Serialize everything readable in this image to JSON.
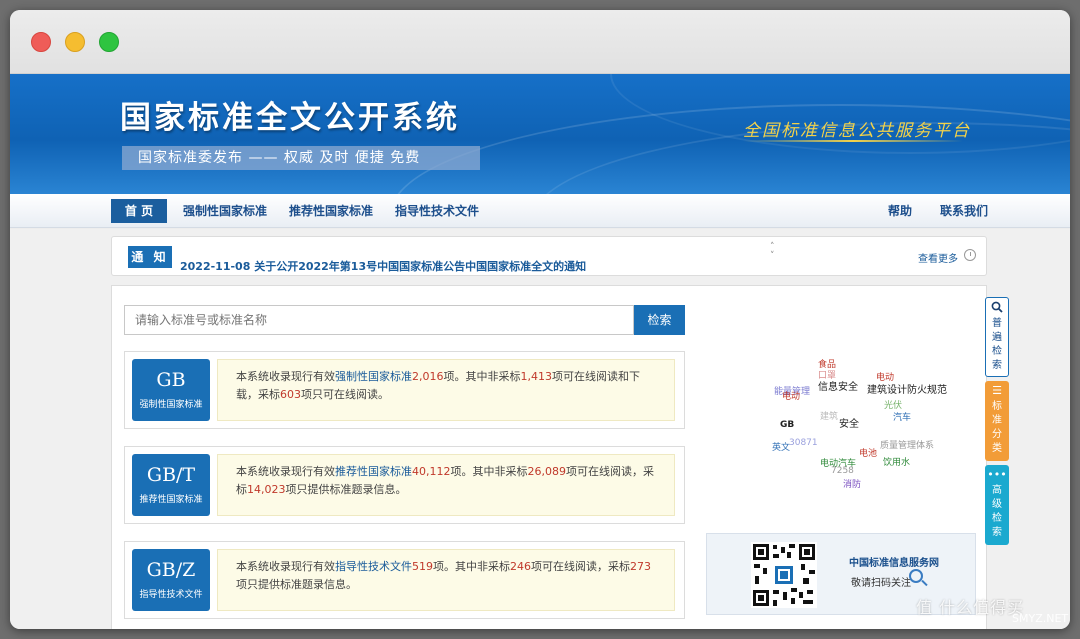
{
  "banner": {
    "title": "国家标准全文公开系统",
    "slogan": "国家标准委发布 —— 权威 及时 便捷 免费",
    "platform": "全国标准信息公共服务平台"
  },
  "nav": {
    "home": "首 页",
    "mandatory": "强制性国家标准",
    "recommended": "推荐性国家标准",
    "guidance": "指导性技术文件",
    "help": "帮助",
    "contact": "联系我们"
  },
  "notice": {
    "badge": "通 知",
    "text": "2022-11-08  关于公开2022年第13号中国国家标准公告中国国家标准全文的通知",
    "more": "查看更多"
  },
  "search": {
    "placeholder": "请输入标准号或标准名称",
    "button": "检索"
  },
  "standards": [
    {
      "code": "GB",
      "category": "强制性国家标准",
      "t1": "本系统收录现行有效",
      "link": "强制性国家标准",
      "count": "2,016",
      "t2": "项。其中非采标",
      "n2": "1,413",
      "t3": "项可在线阅读和下载，采标",
      "n3": "603",
      "t4": "项只可在线阅读。"
    },
    {
      "code": "GB/T",
      "category": "推荐性国家标准",
      "t1": "本系统收录现行有效",
      "link": "推荐性国家标准",
      "count": "40,112",
      "t2": "项。其中非采标",
      "n2": "26,089",
      "t3": "项可在线阅读，采标",
      "n3": "14,023",
      "t4": "项只提供标准题录信息。"
    },
    {
      "code": "GB/Z",
      "category": "指导性技术文件",
      "t1": "本系统收录现行有效",
      "link": "指导性技术文件",
      "count": "519",
      "t2": "项。其中非采标",
      "n2": "246",
      "t3": "项可在线阅读，采标",
      "n3": "273",
      "t4": "项只提供标准题录信息。"
    }
  ],
  "tags": [
    {
      "text": "食品",
      "color": "#c0392b"
    },
    {
      "text": "口罩",
      "color": "#d98c8c"
    },
    {
      "text": "信息安全",
      "color": "#222222"
    },
    {
      "text": "电动",
      "color": "#c0392b"
    },
    {
      "text": "能量管理",
      "color": "#7a7ad0"
    },
    {
      "text": "电动",
      "color": "#c0392b"
    },
    {
      "text": "建筑设计防火规范",
      "color": "#222222"
    },
    {
      "text": "光伏",
      "color": "#77b36b"
    },
    {
      "text": "汽车",
      "color": "#2f6fb5"
    },
    {
      "text": "建筑",
      "color": "#bbbbbb"
    },
    {
      "text": "安全",
      "color": "#222222"
    },
    {
      "text": "GB",
      "color": "#222222"
    },
    {
      "text": "质量管理体系",
      "color": "#999999"
    },
    {
      "text": "英文",
      "color": "#2f6fb5"
    },
    {
      "text": "30871",
      "color": "#9aa0dd"
    },
    {
      "text": "电池",
      "color": "#c0392b"
    },
    {
      "text": "电动汽车",
      "color": "#2f8a3a"
    },
    {
      "text": "饮用水",
      "color": "#2f8a3a"
    },
    {
      "text": "7258",
      "color": "#999999"
    },
    {
      "text": "消防",
      "color": "#7a4fc0"
    }
  ],
  "qr": {
    "title": "中国标准信息服务网",
    "subtitle": "敬请扫码关注"
  },
  "side": {
    "general": "普遍检索",
    "classify": "标准分类",
    "advanced": "高级检索"
  },
  "watermark": {
    "main": "值 什么值得买",
    "sub": "SMYZ.NET"
  }
}
